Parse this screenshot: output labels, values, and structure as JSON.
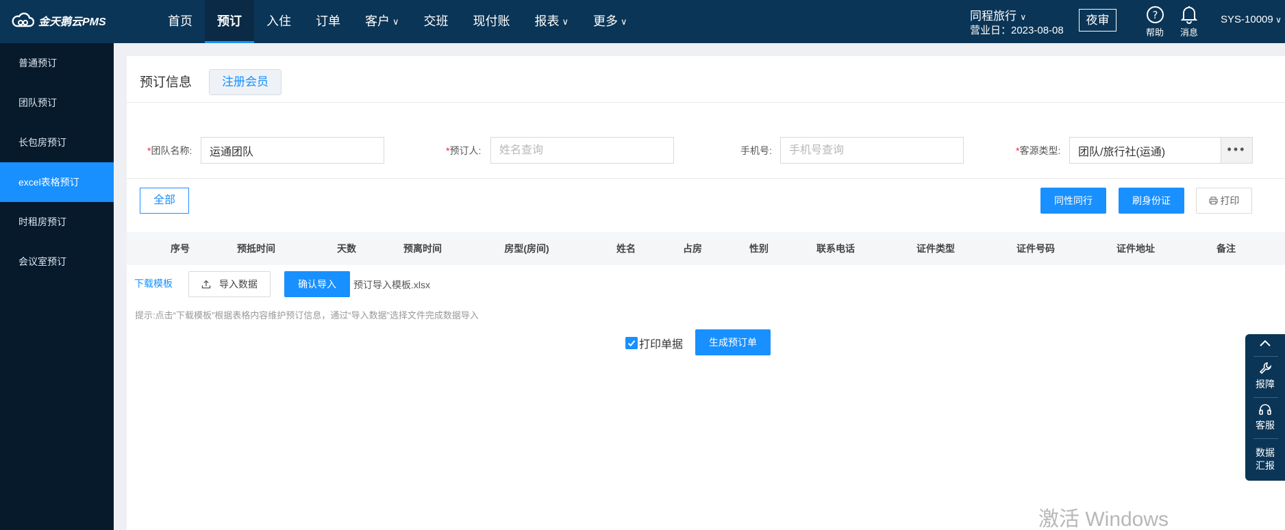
{
  "app": {
    "logo_text": "金天鹅云PMS"
  },
  "nav": {
    "items": [
      {
        "label": "首页",
        "dropdown": false,
        "active": false
      },
      {
        "label": "预订",
        "dropdown": false,
        "active": true
      },
      {
        "label": "入住",
        "dropdown": false,
        "active": false
      },
      {
        "label": "订单",
        "dropdown": false,
        "active": false
      },
      {
        "label": "客户",
        "dropdown": true,
        "active": false
      },
      {
        "label": "交班",
        "dropdown": false,
        "active": false
      },
      {
        "label": "现付账",
        "dropdown": false,
        "active": false
      },
      {
        "label": "报表",
        "dropdown": true,
        "active": false
      },
      {
        "label": "更多",
        "dropdown": true,
        "active": false
      }
    ]
  },
  "header": {
    "hotel_name": "同程旅行",
    "business_date": "营业日：2023-08-08",
    "night_audit_label": "夜审",
    "help_label": "帮助",
    "message_label": "消息",
    "user": "SYS-10009"
  },
  "sidebar": {
    "items": [
      {
        "label": "普通预订",
        "active": false
      },
      {
        "label": "团队预订",
        "active": false
      },
      {
        "label": "长包房预订",
        "active": false
      },
      {
        "label": "excel表格预订",
        "active": true
      },
      {
        "label": "时租房预订",
        "active": false
      },
      {
        "label": "会议室预订",
        "active": false
      }
    ]
  },
  "panel": {
    "title": "预订信息",
    "register_member_label": "注册会员"
  },
  "form": {
    "team_name_label": "团队名称:",
    "team_name_value": "运通团队",
    "booker_label": "预订人:",
    "booker_placeholder": "姓名查询",
    "phone_label": "手机号:",
    "phone_placeholder": "手机号查询",
    "source_label": "客源类型:",
    "source_value": "团队/旅行社(运通)",
    "more_label": "•••",
    "required_mark": "*"
  },
  "toolbar": {
    "all_label": "全部",
    "same_sex_label": "同性同行",
    "id_card_label": "刷身份证",
    "print_label": "打印"
  },
  "table": {
    "columns": [
      "序号",
      "预抵时间",
      "天数",
      "预离时间",
      "房型(房间)",
      "姓名",
      "占房",
      "性别",
      "联系电话",
      "证件类型",
      "证件号码",
      "证件地址",
      "备注"
    ]
  },
  "import": {
    "download_template_label": "下载模板",
    "import_data_label": "导入数据",
    "confirm_import_label": "确认导入",
    "file_name": "预订导入模板.xlsx",
    "hint": "提示:点击“下载模板”根据表格内容维护预订信息，通过“导入数据”选择文件完成数据导入"
  },
  "footer_actions": {
    "print_receipt_label": "打印单据",
    "print_receipt_checked": true,
    "generate_label": "生成预订单"
  },
  "float_bar": {
    "report_label": "报障",
    "service_label": "客服",
    "data_report_line1": "数据",
    "data_report_line2": "汇报"
  },
  "watermark": "激活 Windows",
  "colors": {
    "primary": "#1890ff",
    "topbar": "#0b3556",
    "sidebar": "#061a2c"
  }
}
